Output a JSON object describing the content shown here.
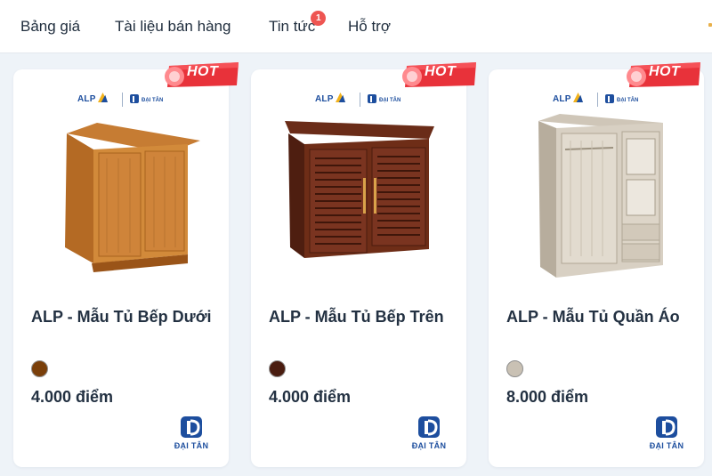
{
  "nav": {
    "items": [
      {
        "label": "Bảng giá"
      },
      {
        "label": "Tài liệu bán hàng"
      },
      {
        "label": "Tin tức",
        "badge": "1"
      },
      {
        "label": "Hỗ trợ"
      }
    ]
  },
  "products": [
    {
      "title": "ALP - Mẫu Tủ Bếp Dưới",
      "points": "4.000 điểm",
      "swatch_color": "#7a3f0a",
      "hot_label": "HOT",
      "brand_alp": "ALP",
      "brand_dt": "ĐẠI TÂN",
      "icon": "lower-kitchen-cabinet"
    },
    {
      "title": "ALP - Mẫu Tủ Bếp Trên",
      "points": "4.000 điểm",
      "swatch_color": "#4a1d10",
      "hot_label": "HOT",
      "brand_alp": "ALP",
      "brand_dt": "ĐẠI TÂN",
      "icon": "upper-kitchen-cabinet"
    },
    {
      "title": "ALP - Mẫu Tủ Quần Áo",
      "points": "8.000 điểm",
      "swatch_color": "#c9c1b4",
      "hot_label": "HOT",
      "brand_alp": "ALP",
      "brand_dt": "ĐẠI TÂN",
      "icon": "wardrobe"
    }
  ],
  "colors": {
    "accent_red": "#ee3a3f",
    "brand_blue": "#1d4e9e",
    "page_bg": "#eef3f8"
  }
}
